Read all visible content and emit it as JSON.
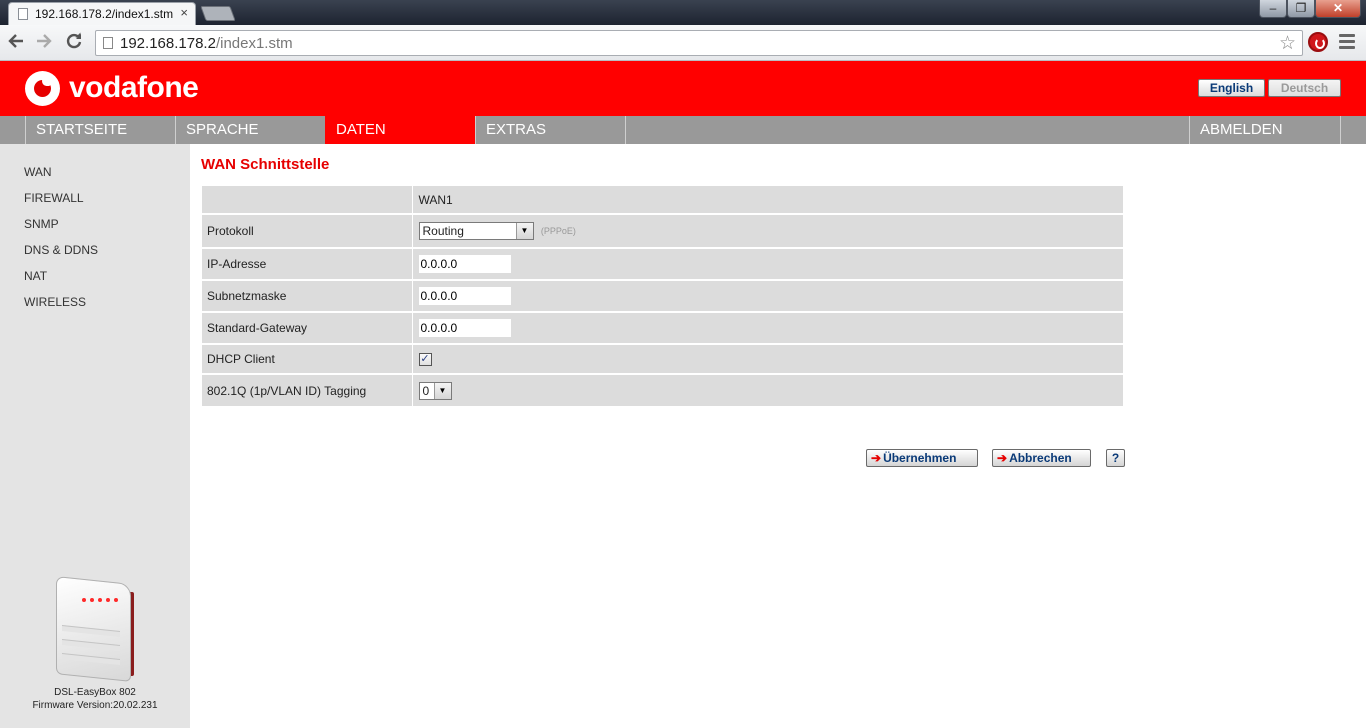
{
  "browser": {
    "tab_title": "192.168.178.2/index1.stm",
    "tab_close": "×",
    "url_host": "192.168.178.2",
    "url_path": "/index1.stm"
  },
  "header": {
    "logo_text": "vodafone",
    "lang_english": "English",
    "lang_deutsch": "Deutsch"
  },
  "nav": {
    "items": [
      "STARTSEITE",
      "SPRACHE",
      "DATEN",
      "EXTRAS",
      "ABMELDEN"
    ],
    "active": "DATEN"
  },
  "sidebar": {
    "items": [
      "WAN",
      "FIREWALL",
      "SNMP",
      "DNS & DDNS",
      "NAT",
      "WIRELESS"
    ],
    "device_name": "DSL-EasyBox 802",
    "firmware": "Firmware Version:20.02.231"
  },
  "main": {
    "title": "WAN Schnittstelle",
    "column_header": "WAN1",
    "rows": {
      "protokoll": {
        "label": "Protokoll",
        "value": "Routing",
        "hint": "(PPPoE)"
      },
      "ip": {
        "label": "IP-Adresse",
        "value": "0.0.0.0"
      },
      "subnet": {
        "label": "Subnetzmaske",
        "value": "0.0.0.0"
      },
      "gateway": {
        "label": "Standard-Gateway",
        "value": "0.0.0.0"
      },
      "dhcp": {
        "label": "DHCP Client",
        "checked": true,
        "check_glyph": "✓"
      },
      "vlan": {
        "label": "802.1Q (1p/VLAN ID) Tagging",
        "value": "0"
      }
    },
    "buttons": {
      "apply": "Übernehmen",
      "cancel": "Abbrechen",
      "help": "?"
    }
  },
  "colors": {
    "brand_red": "#ff0000",
    "nav_gray": "#999999",
    "sidebar_bg": "#e4e4e4",
    "row_bg": "#dcdcdc",
    "title_red": "#e60000"
  },
  "icons": {
    "back": "back-arrow-icon",
    "forward": "forward-arrow-icon",
    "reload": "reload-icon",
    "bookmark": "star-icon",
    "menu": "hamburger-menu-icon",
    "extension": "adblock-icon"
  }
}
